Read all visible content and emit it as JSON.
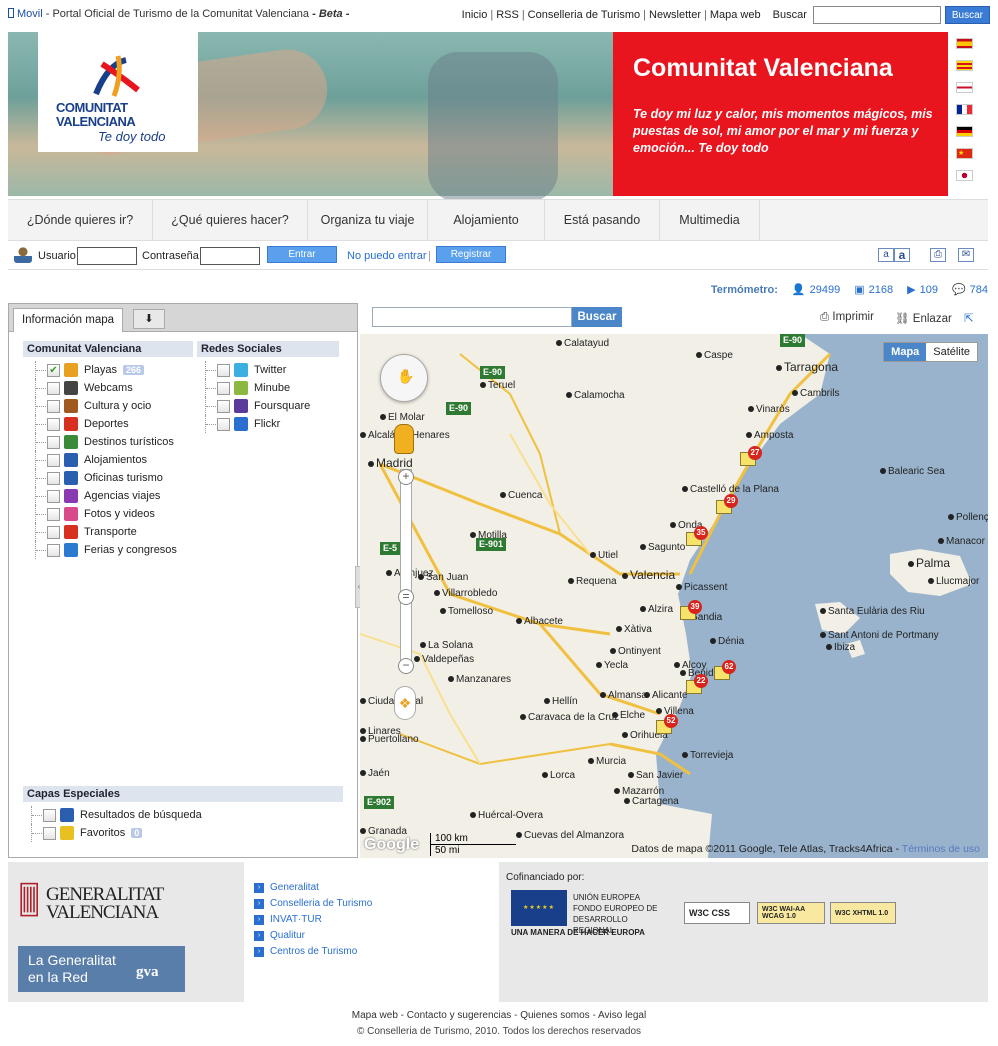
{
  "topbar": {
    "mobile": "Movil",
    "title_prefix": "- Portal Oficial de Turismo de la Comunitat Valenciana",
    "title_beta": "- Beta -",
    "links": [
      "Inicio",
      "RSS",
      "Conselleria de Turismo",
      "Newsletter",
      "Mapa web"
    ],
    "search_label": "Buscar",
    "search_button": "Buscar"
  },
  "banner": {
    "logo_line1": "COMUNITAT",
    "logo_line2": "VALENCIANA",
    "logo_tagline": "Te doy todo",
    "heading": "Comunitat Valenciana",
    "slogan": "Te doy mi luz y calor, mis momentos mágicos, mis puestas de sol, mi amor por el mar y mi fuerza y emoción... Te doy todo"
  },
  "nav": {
    "items": [
      "¿Dónde quieres ir?",
      "¿Qué quieres hacer?",
      "Organiza tu viaje",
      "Alojamiento",
      "Está pasando",
      "Multimedia"
    ]
  },
  "login": {
    "user_label": "Usuario",
    "password_label": "Contraseña",
    "enter_button": "Entrar",
    "cant_login": "No puedo entrar",
    "register_button": "Registrar",
    "font_small": "a",
    "font_large": "a"
  },
  "thermometer": {
    "label": "Termómetro:",
    "users": "29499",
    "photos": "2168",
    "videos": "109",
    "comments": "784"
  },
  "panel": {
    "tab_info": "Información mapa",
    "cv_header": "Comunitat Valenciana",
    "cv_layers": [
      {
        "label": "Playas",
        "badge": "266",
        "checked": true,
        "color": "#e8a020"
      },
      {
        "label": "Webcams",
        "color": "#444444"
      },
      {
        "label": "Cultura y ocio",
        "color": "#a05a20"
      },
      {
        "label": "Deportes",
        "color": "#d83020"
      },
      {
        "label": "Destinos turísticos",
        "color": "#3a8a3a"
      },
      {
        "label": "Alojamientos",
        "color": "#2a5fb0"
      },
      {
        "label": "Oficinas turismo",
        "color": "#2a5fb0"
      },
      {
        "label": "Agencias viajes",
        "color": "#8a3ab0"
      },
      {
        "label": "Fotos y videos",
        "color": "#d84a8a"
      },
      {
        "label": "Transporte",
        "color": "#d83020"
      },
      {
        "label": "Ferias y congresos",
        "color": "#2a7ad0"
      }
    ],
    "social_header": "Redes Sociales",
    "social_layers": [
      {
        "label": "Twitter",
        "color": "#3ab0e0"
      },
      {
        "label": "Minube",
        "color": "#8ab840"
      },
      {
        "label": "Foursquare",
        "color": "#5a3a9a"
      },
      {
        "label": "Flickr",
        "color": "#2a6fd0"
      }
    ],
    "special_header": "Capas Especiales",
    "special_layers": [
      {
        "label": "Resultados de búsqueda",
        "color": "#2a5fb0"
      },
      {
        "label": "Favoritos",
        "badge": "0",
        "color": "#e8c020"
      }
    ]
  },
  "map": {
    "search_button": "Buscar",
    "print": "Imprimir",
    "link": "Enlazar",
    "type_map": "Mapa",
    "type_satellite": "Satélite",
    "copyright": "Datos de mapa ©2011 Google, Tele Atlas, Tracks4Africa -",
    "terms": "Términos de uso",
    "scale_km": "100 km",
    "scale_mi": "50 mi",
    "google": "Google",
    "cities": [
      "Tarragona",
      "Madrid",
      "Alcalá de Henares",
      "Cuenca",
      "Castelló de la Plana",
      "Sagunto",
      "Valencia",
      "Albacete",
      "Alicante",
      "Elche",
      "Murcia",
      "Cartagena",
      "Palma",
      "Ibiza",
      "Jaén",
      "Granada",
      "Lorca",
      "Requena",
      "Gandia",
      "Dénia",
      "Benidorm",
      "Orihuela",
      "Torrevieja",
      "Calatayud",
      "Caspe",
      "Cambrils",
      "Amposta",
      "Balearic Sea",
      "Teruel",
      "Calamocha",
      "Villarrobledo",
      "Tomelloso",
      "Valdepeñas",
      "Alcoy",
      "Yecla",
      "Ontinyent",
      "Xàtiva",
      "Hellín",
      "Caravaca de la Cruz",
      "Mazarrón",
      "San Javier",
      "Ciudad Real",
      "Utiel",
      "Puertollano",
      "Linares",
      "Onda",
      "Vinaròs",
      "Alzira",
      "Picassent",
      "Huércal-Overa",
      "Santa Eulària des Riu",
      "Llucmajor",
      "Pollença",
      "Manacor",
      "Sant Antoni de Portmany",
      "El Molar",
      "Aranjuez",
      "Cuevas del Almanzora",
      "La Solana",
      "San Juan",
      "Motilla",
      "Almansa",
      "Manzanares",
      "Villena"
    ],
    "routes": [
      "E-90",
      "E-90",
      "E-90",
      "E-901",
      "E-5",
      "E-902"
    ],
    "markers": [
      "27",
      "29",
      "35",
      "39",
      "62",
      "22",
      "52"
    ]
  },
  "footer": {
    "gva_line1": "GENERALITAT",
    "gva_line2": "VALENCIANA",
    "gen_red_line1": "La Generalitat",
    "gen_red_line2": "en la Red",
    "gva_brand": "gva",
    "links": [
      "Generalitat",
      "Conselleria de Turismo",
      "INVAT·TUR",
      "Qualitur",
      "Centros de Turismo"
    ],
    "cofin": "Cofinanciado por:",
    "eu_1": "UNIÓN EUROPEA",
    "eu_2": "FONDO EUROPEO DE",
    "eu_3": "DESARROLLO REGIONAL",
    "eu_caption": "UNA MANERA DE HACER EUROPA",
    "badges": [
      "W3C CSS",
      "W3C WAI-AA WCAG 1.0",
      "W3C XHTML 1.0"
    ]
  },
  "bottom": {
    "links": [
      "Mapa web",
      "Contacto y sugerencias",
      "Quienes somos",
      "Aviso legal"
    ],
    "copyright": "© Conselleria de Turismo, 2010. Todos los derechos reservados"
  }
}
